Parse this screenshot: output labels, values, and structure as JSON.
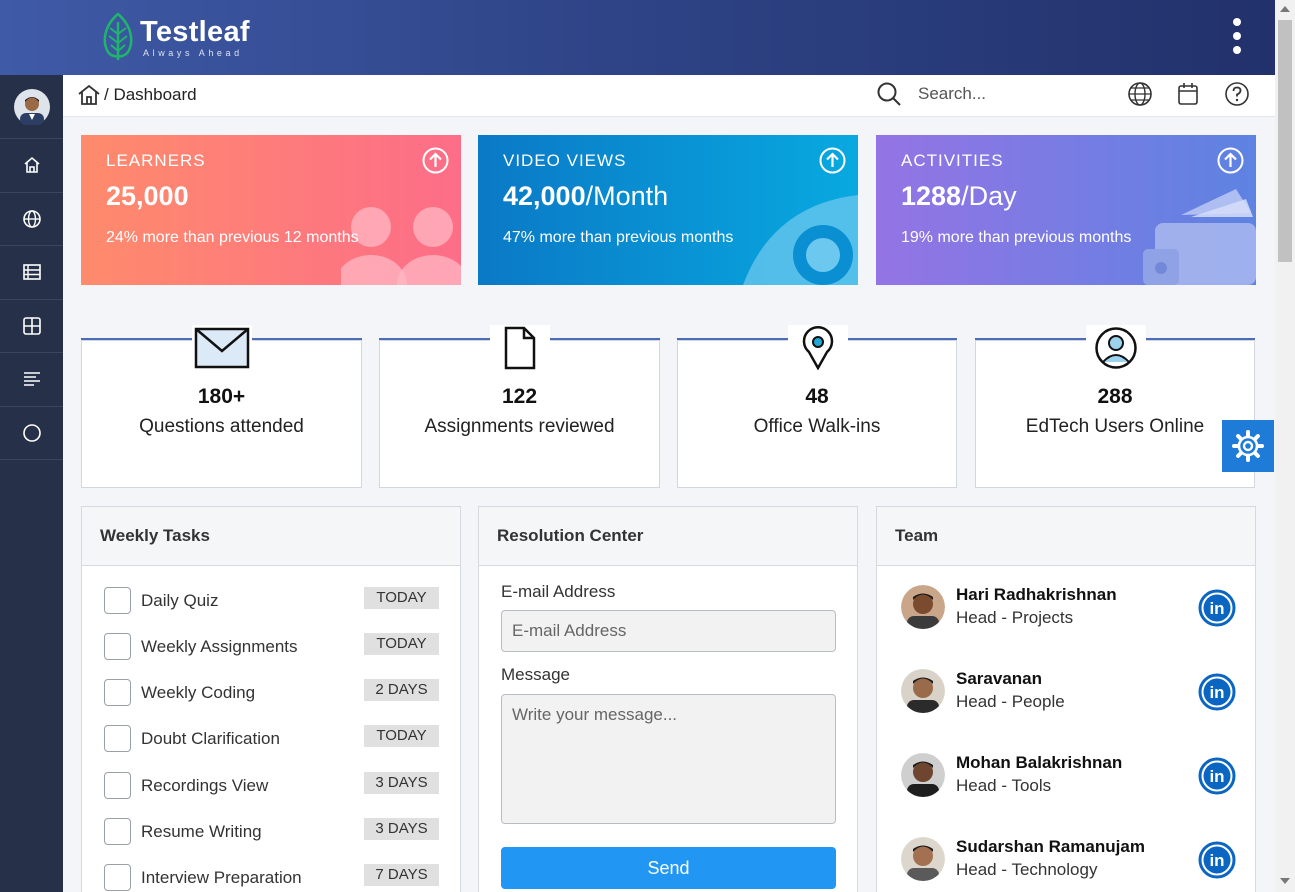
{
  "brand": {
    "name": "Testleaf",
    "tagline": "Always Ahead",
    "leaf_color": "#1fb56a"
  },
  "header": {
    "menu_icon": "kebab-menu-icon"
  },
  "sidebar": {
    "avatar": "user-avatar",
    "items": [
      {
        "icon": "home-icon"
      },
      {
        "icon": "globe-icon"
      },
      {
        "icon": "list-icon"
      },
      {
        "icon": "grid-icon"
      },
      {
        "icon": "align-left-icon"
      },
      {
        "icon": "circle-icon"
      }
    ]
  },
  "breadcrumb": {
    "current": "/ Dashboard"
  },
  "search": {
    "placeholder": "Search..."
  },
  "header_icons": [
    "globe-icon",
    "calendar-icon",
    "help-icon"
  ],
  "stats": [
    {
      "label": "LEARNERS",
      "value": "25,000",
      "unit": "",
      "desc": "24% more than previous 12 months",
      "gradient": [
        "#fe8b6c",
        "#fd6d88"
      ]
    },
    {
      "label": "VIDEO VIEWS",
      "value": "42,000",
      "unit": "/Month",
      "desc": "47% more than previous months",
      "gradient": [
        "#0a79c6",
        "#08a9e0"
      ]
    },
    {
      "label": "ACTIVITIES",
      "value": "1288",
      "unit": "/Day",
      "desc": "19% more than previous months",
      "gradient": [
        "#9474e4",
        "#5d83e2"
      ]
    }
  ],
  "metrics": [
    {
      "icon": "envelope-icon",
      "value": "180+",
      "label": "Questions attended"
    },
    {
      "icon": "document-icon",
      "value": "122",
      "label": "Assignments reviewed"
    },
    {
      "icon": "location-pin-icon",
      "value": "48",
      "label": "Office Walk-ins"
    },
    {
      "icon": "user-circle-icon",
      "value": "288",
      "label": "EdTech Users Online"
    }
  ],
  "weekly_tasks": {
    "title": "Weekly Tasks",
    "items": [
      {
        "name": "Daily Quiz",
        "due": "TODAY"
      },
      {
        "name": "Weekly Assignments",
        "due": "TODAY"
      },
      {
        "name": "Weekly Coding",
        "due": "2 DAYS"
      },
      {
        "name": "Doubt Clarification",
        "due": "TODAY"
      },
      {
        "name": "Recordings View",
        "due": "3 DAYS"
      },
      {
        "name": "Resume Writing",
        "due": "3 DAYS"
      },
      {
        "name": "Interview Preparation",
        "due": "7 DAYS"
      }
    ]
  },
  "resolution": {
    "title": "Resolution Center",
    "email_label": "E-mail Address",
    "email_placeholder": "E-mail Address",
    "message_label": "Message",
    "message_placeholder": "Write your message...",
    "send_label": "Send"
  },
  "team": {
    "title": "Team",
    "members": [
      {
        "name": "Hari Radhakrishnan",
        "role": "Head - Projects"
      },
      {
        "name": "Saravanan",
        "role": "Head - People"
      },
      {
        "name": "Mohan Balakrishnan",
        "role": "Head - Tools"
      },
      {
        "name": "Sudarshan Ramanujam",
        "role": "Head - Technology"
      }
    ]
  },
  "colors": {
    "accent": "#4b6cb7",
    "send": "#2196f3",
    "linkedin": "#0a66c2",
    "sidebar": "#263048"
  }
}
